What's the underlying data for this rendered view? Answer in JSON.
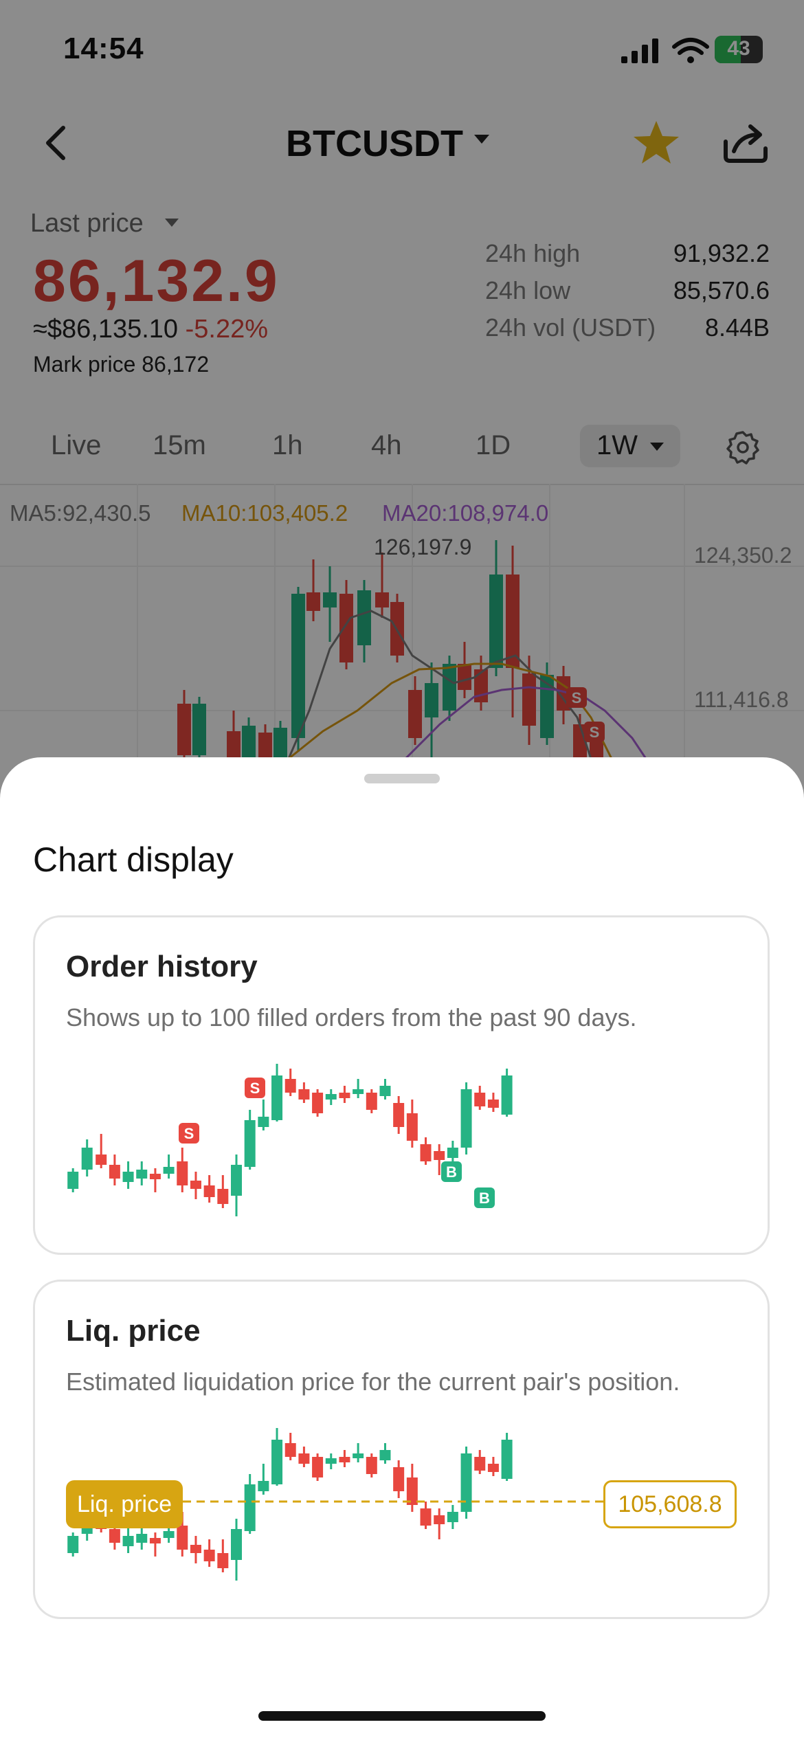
{
  "status_bar": {
    "time": "14:54",
    "battery": "43"
  },
  "header": {
    "pair": "BTCUSDT"
  },
  "price_block": {
    "last_price_label": "Last price",
    "last_price": "86,132.9",
    "usd_price": "≈$86,135.10",
    "change": "-5.22%",
    "mark_label": "Mark price",
    "mark_value": "86,172",
    "stats": [
      {
        "label": "24h high",
        "value": "91,932.2"
      },
      {
        "label": "24h low",
        "value": "85,570.6"
      },
      {
        "label": "24h vol (USDT)",
        "value": "8.44B"
      }
    ]
  },
  "intervals": [
    "Live",
    "15m",
    "1h",
    "4h",
    "1D",
    "1W"
  ],
  "active_interval": "1W",
  "chart": {
    "ma5": "MA5:92,430.5",
    "ma10": "MA10:103,405.2",
    "ma20": "MA20:108,974.0",
    "high_marker": "126,197.9",
    "y_labels": [
      "124,350.2",
      "111,416.8"
    ],
    "colors": {
      "up": "#26b384",
      "down": "#e8473f",
      "ma5": "#7a7a7a",
      "ma10": "#d79a14",
      "ma20": "#a65fd1"
    }
  },
  "sheet": {
    "title": "Chart display",
    "cards": [
      {
        "title": "Order history",
        "description": "Shows up to  100 filled orders from the past 90 days.",
        "markers": [
          "S",
          "S",
          "B",
          "B"
        ]
      },
      {
        "title": "Liq. price",
        "description": "Estimated liquidation price for the current pair's position.",
        "liq_tag": "Liq. price",
        "liq_value": "105,608.8"
      }
    ]
  }
}
